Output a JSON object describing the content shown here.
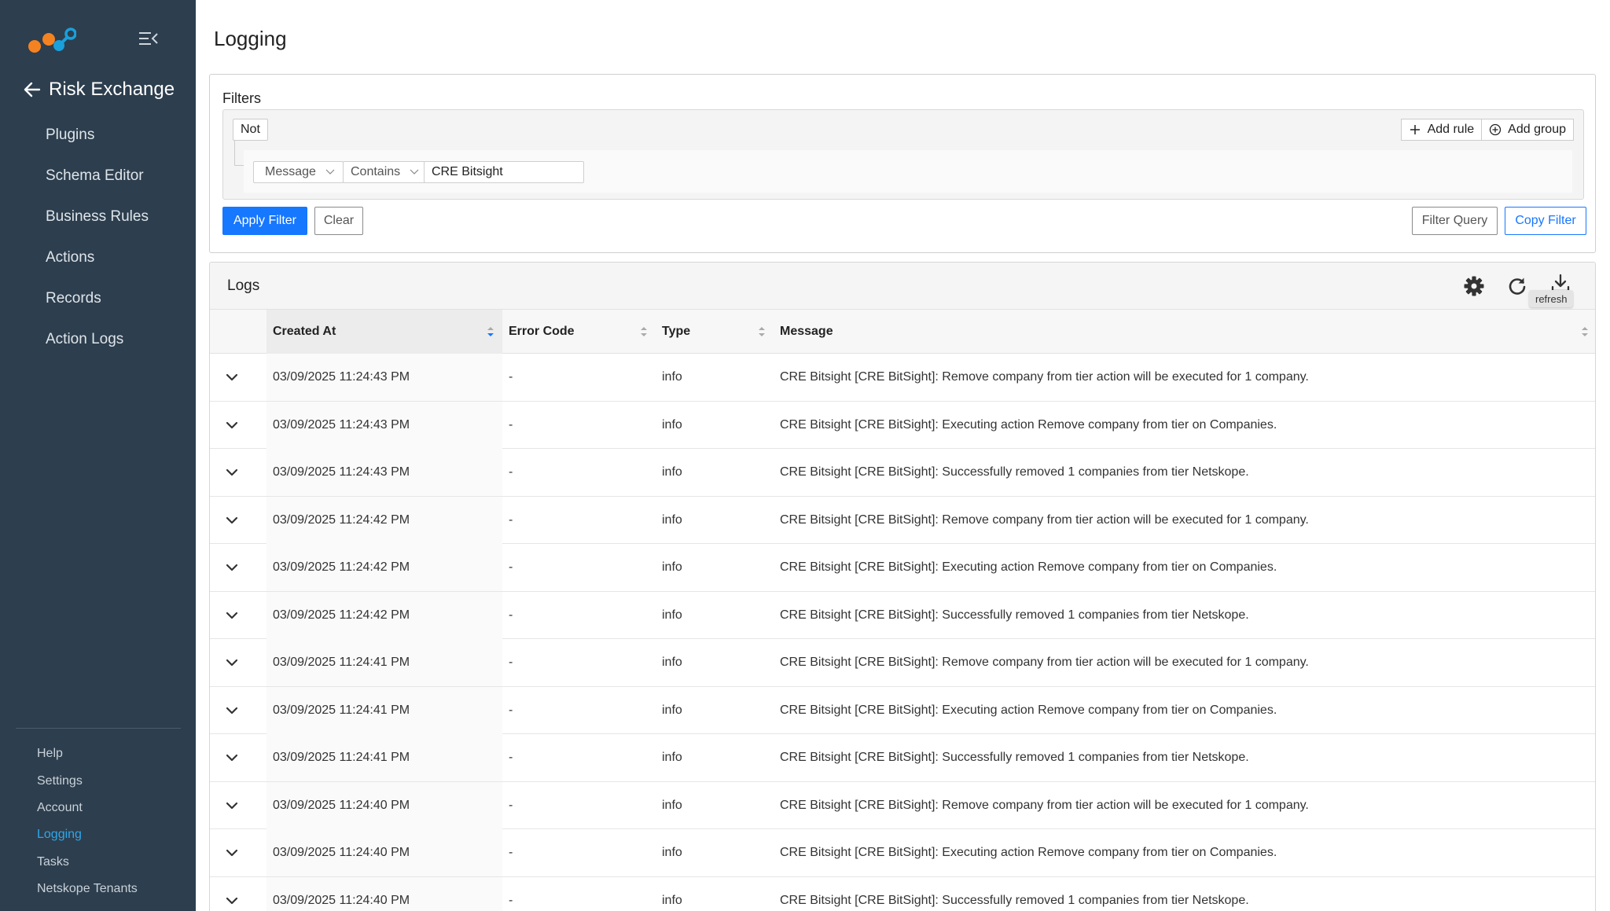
{
  "sidebar": {
    "back_label": "Risk Exchange",
    "nav": [
      {
        "label": "Plugins"
      },
      {
        "label": "Schema Editor"
      },
      {
        "label": "Business Rules"
      },
      {
        "label": "Actions"
      },
      {
        "label": "Records"
      },
      {
        "label": "Action Logs"
      }
    ],
    "bottom": [
      {
        "label": "Help"
      },
      {
        "label": "Settings"
      },
      {
        "label": "Account"
      },
      {
        "label": "Logging",
        "active": true
      },
      {
        "label": "Tasks"
      },
      {
        "label": "Netskope Tenants"
      }
    ]
  },
  "page": {
    "title": "Logging"
  },
  "filters": {
    "title": "Filters",
    "not_label": "Not",
    "add_rule_label": "Add rule",
    "add_group_label": "Add group",
    "rule": {
      "field": "Message",
      "operator": "Contains",
      "value": "CRE Bitsight"
    },
    "apply_label": "Apply Filter",
    "clear_label": "Clear",
    "filter_query_label": "Filter Query",
    "copy_filter_label": "Copy Filter"
  },
  "logs": {
    "title": "Logs",
    "tooltip": "refresh",
    "columns": {
      "created_at": "Created At",
      "error_code": "Error Code",
      "type": "Type",
      "message": "Message"
    },
    "rows": [
      {
        "created": "03/09/2025 11:24:43 PM",
        "code": "-",
        "type": "info",
        "message": "CRE Bitsight [CRE BitSight]: Remove company from tier action will be executed for 1 company."
      },
      {
        "created": "03/09/2025 11:24:43 PM",
        "code": "-",
        "type": "info",
        "message": "CRE Bitsight [CRE BitSight]: Executing action Remove company from tier on Companies."
      },
      {
        "created": "03/09/2025 11:24:43 PM",
        "code": "-",
        "type": "info",
        "message": "CRE Bitsight [CRE BitSight]: Successfully removed 1 companies from tier Netskope."
      },
      {
        "created": "03/09/2025 11:24:42 PM",
        "code": "-",
        "type": "info",
        "message": "CRE Bitsight [CRE BitSight]: Remove company from tier action will be executed for 1 company."
      },
      {
        "created": "03/09/2025 11:24:42 PM",
        "code": "-",
        "type": "info",
        "message": "CRE Bitsight [CRE BitSight]: Executing action Remove company from tier on Companies."
      },
      {
        "created": "03/09/2025 11:24:42 PM",
        "code": "-",
        "type": "info",
        "message": "CRE Bitsight [CRE BitSight]: Successfully removed 1 companies from tier Netskope."
      },
      {
        "created": "03/09/2025 11:24:41 PM",
        "code": "-",
        "type": "info",
        "message": "CRE Bitsight [CRE BitSight]: Remove company from tier action will be executed for 1 company."
      },
      {
        "created": "03/09/2025 11:24:41 PM",
        "code": "-",
        "type": "info",
        "message": "CRE Bitsight [CRE BitSight]: Executing action Remove company from tier on Companies."
      },
      {
        "created": "03/09/2025 11:24:41 PM",
        "code": "-",
        "type": "info",
        "message": "CRE Bitsight [CRE BitSight]: Successfully removed 1 companies from tier Netskope."
      },
      {
        "created": "03/09/2025 11:24:40 PM",
        "code": "-",
        "type": "info",
        "message": "CRE Bitsight [CRE BitSight]: Remove company from tier action will be executed for 1 company."
      },
      {
        "created": "03/09/2025 11:24:40 PM",
        "code": "-",
        "type": "info",
        "message": "CRE Bitsight [CRE BitSight]: Executing action Remove company from tier on Companies."
      },
      {
        "created": "03/09/2025 11:24:40 PM",
        "code": "-",
        "type": "info",
        "message": "CRE Bitsight [CRE BitSight]: Successfully removed 1 companies from tier Netskope."
      }
    ]
  },
  "colors": {
    "sidebar_bg": "#2d3e4e",
    "primary": "#1677ff",
    "active_link": "#2ea7e8"
  },
  "icons": {
    "logo": "netskope-logo",
    "collapse": "menu-collapse-icon",
    "back": "arrow-left-icon",
    "settings": "gear-icon",
    "refresh": "refresh-icon",
    "download": "download-icon",
    "expand": "chevron-down-icon"
  }
}
